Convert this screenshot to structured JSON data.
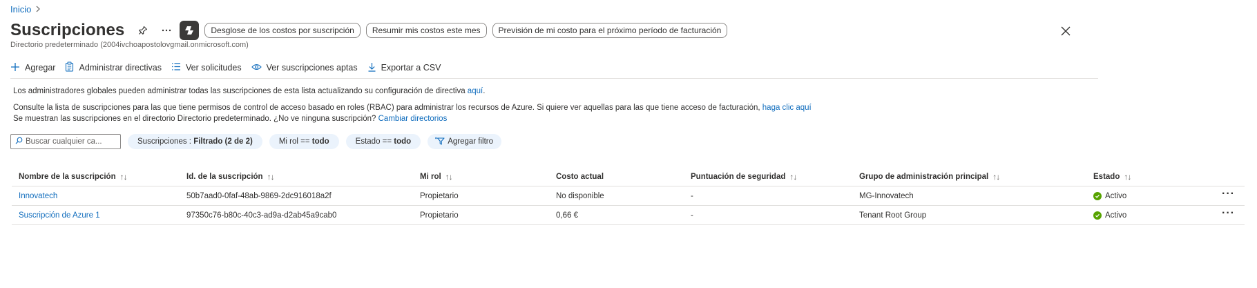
{
  "breadcrumb": {
    "home": "Inicio"
  },
  "header": {
    "title": "Suscripciones",
    "subtitle": "Directorio predeterminado (2004ivchoapostolovgmail.onmicrosoft.com)",
    "prompts": [
      "Desglose de los costos por suscripción",
      "Resumir mis costos este mes",
      "Previsión de mi costo para el próximo período de facturación"
    ]
  },
  "toolbar": {
    "add": "Agregar",
    "manage_policies": "Administrar directivas",
    "view_requests": "Ver solicitudes",
    "view_eligible": "Ver suscripciones aptas",
    "export_csv": "Exportar a CSV"
  },
  "info": {
    "line1_text": "Los administradores globales pueden administrar todas las suscripciones de esta lista actualizando su configuración de directiva ",
    "line1_link": "aquí",
    "line1_end": ".",
    "line2_text": "Consulte la lista de suscripciones para las que tiene permisos de control de acceso basado en roles (RBAC) para administrar los recursos de Azure. Si quiere ver aquellas para las que tiene acceso de facturación, ",
    "line2_link": "haga clic aquí",
    "line3_text": "Se muestran las suscripciones en el directorio Directorio predeterminado. ¿No ve ninguna suscripción? ",
    "line3_link": "Cambiar directorios"
  },
  "filters": {
    "search_placeholder": "Buscar cualquier ca...",
    "subscriptions_label": "Suscripciones : ",
    "subscriptions_value": "Filtrado (2 de 2)",
    "role_label": "Mi rol == ",
    "role_value": "todo",
    "state_label": "Estado == ",
    "state_value": "todo",
    "add_filter": "Agregar filtro"
  },
  "table": {
    "columns": [
      "Nombre de la suscripción",
      "Id. de la suscripción",
      "Mi rol",
      "Costo actual",
      "Puntuación de seguridad",
      "Grupo de administración principal",
      "Estado"
    ],
    "rows": [
      {
        "name": "Innovatech",
        "id": "50b7aad0-0faf-48ab-9869-2dc916018a2f",
        "role": "Propietario",
        "cost": "No disponible",
        "score": "-",
        "group": "MG-Innovatech",
        "status": "Activo"
      },
      {
        "name": "Suscripción de Azure 1",
        "id": "97350c76-b80c-40c3-ad9a-d2ab45a9cab0",
        "role": "Propietario",
        "cost": "0,66 €",
        "score": "-",
        "group": "Tenant Root Group",
        "status": "Activo"
      }
    ]
  },
  "colors": {
    "link": "#0f6cbd",
    "status_active": "#57a300",
    "chip_bg": "#ebf3fc"
  },
  "icons": [
    "chevron-right-icon",
    "pin-icon",
    "ellipsis-icon",
    "copilot-icon",
    "close-icon",
    "plus-icon",
    "clipboard-icon",
    "list-icon",
    "eye-icon",
    "download-icon",
    "search-icon",
    "add-filter-icon",
    "checkmark-circle-icon"
  ]
}
